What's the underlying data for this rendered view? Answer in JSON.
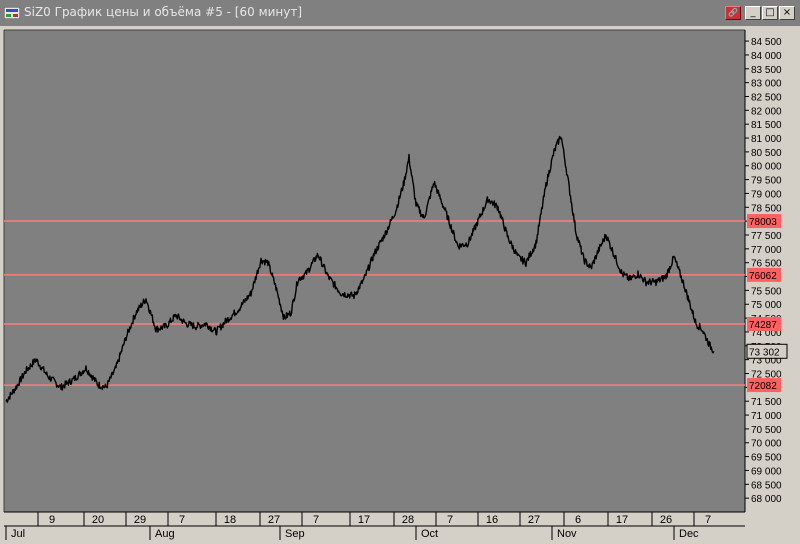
{
  "window": {
    "title": "SiZ0 График цены и объёма #5 - [60 минут]",
    "buttons": {
      "link": "🔗",
      "minimize": "_",
      "maximize": "□",
      "close": "×"
    }
  },
  "colors": {
    "plot_bg": "#808080",
    "axis_bg": "#d4d0c8",
    "price_line": "#000000",
    "level_line": "#ff7a7a",
    "level_label_bg": "#ff6060"
  },
  "chart_data": {
    "type": "line",
    "instrument": "SiZ0",
    "timeframe": "60 минут",
    "ylim": [
      67500,
      84900
    ],
    "y_ticks": [
      68000,
      68500,
      69000,
      69500,
      70000,
      70500,
      71000,
      71500,
      72000,
      72500,
      73000,
      73500,
      74000,
      74500,
      75000,
      75500,
      76000,
      76500,
      77000,
      77500,
      78000,
      78500,
      79000,
      79500,
      80000,
      80500,
      81000,
      81500,
      82000,
      82500,
      83000,
      83500,
      84000,
      84500
    ],
    "y_tick_labels": [
      "68 000",
      "68 500",
      "69 000",
      "69 500",
      "70 000",
      "70 500",
      "71 000",
      "71 500",
      "72 000",
      "72 500",
      "73 000",
      "73 500",
      "74 000",
      "74 500",
      "75 000",
      "75 500",
      "76 000",
      "76 500",
      "77 000",
      "77 500",
      "78 000",
      "78 500",
      "79 000",
      "79 500",
      "80 000",
      "80 500",
      "81 000",
      "81 500",
      "82 000",
      "82 500",
      "83 000",
      "83 500",
      "84 000",
      "84 500"
    ],
    "x_day_ticks": [
      "9",
      "20",
      "29",
      "7",
      "18",
      "27",
      "7",
      "17",
      "28",
      "7",
      "16",
      "27",
      "6",
      "17",
      "26",
      "7"
    ],
    "x_month_labels": [
      "Jul",
      "Aug",
      "Sep",
      "Oct",
      "Nov",
      "Dec"
    ],
    "horizontal_levels": [
      {
        "label": "78003",
        "value": 78003
      },
      {
        "label": "76062",
        "value": 76062
      },
      {
        "label": "74287",
        "value": 74287
      },
      {
        "label": "72082",
        "value": 72082
      }
    ],
    "last_price": {
      "label": "73 302",
      "value": 73302
    },
    "series": [
      {
        "x": [
          0,
          10,
          20,
          30,
          42,
          55,
          68,
          80,
          92,
          100,
          110,
          120,
          130,
          140,
          150,
          160,
          170,
          180,
          190,
          200,
          210,
          220,
          232,
          245,
          255,
          262,
          270,
          278,
          285,
          292,
          300,
          312,
          322,
          335,
          348,
          358,
          368,
          380,
          390,
          398,
          403,
          410,
          418,
          428,
          440,
          452,
          462,
          472,
          482,
          492,
          502,
          512,
          520,
          530,
          540,
          548,
          555,
          562,
          570,
          578,
          585,
          592,
          600,
          608,
          616,
          624,
          632,
          640,
          650,
          660,
          668,
          672,
          678,
          684,
          690,
          696,
          700,
          704,
          708
        ],
        "y": [
          71500,
          72000,
          72600,
          73000,
          72400,
          72000,
          72300,
          72700,
          72100,
          72000,
          72700,
          73800,
          74700,
          75200,
          74100,
          74200,
          74600,
          74300,
          74200,
          74300,
          74000,
          74400,
          74800,
          75400,
          76600,
          76500,
          75600,
          74500,
          74700,
          75900,
          76100,
          76800,
          76000,
          75400,
          75300,
          75900,
          76800,
          77600,
          78400,
          79400,
          80300,
          78600,
          78100,
          79400,
          78300,
          77100,
          77200,
          78000,
          78800,
          78500,
          77400,
          76700,
          76500,
          77200,
          79300,
          80500,
          81100,
          79500,
          77600,
          76600,
          76300,
          76900,
          77500,
          76800,
          76100,
          75900,
          76100,
          75800,
          75800,
          76000,
          76700,
          76300,
          75700,
          75000,
          74300,
          74100,
          73800,
          73500,
          73300
        ]
      }
    ]
  }
}
